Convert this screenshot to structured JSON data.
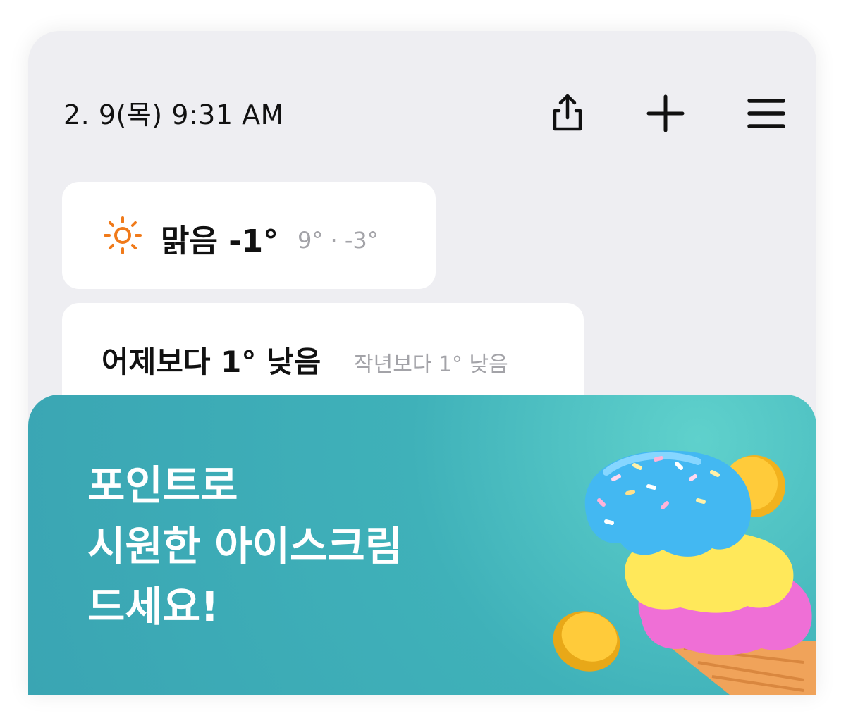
{
  "status": {
    "datetime": "2. 9(목)  9:31 AM"
  },
  "toolbar": {
    "share_icon": "share-icon",
    "add_icon": "plus-icon",
    "menu_icon": "hamburger-menu-icon"
  },
  "weather": {
    "icon": "sun-icon",
    "icon_color": "#f07a1a",
    "condition_temp": "맑음 -1°",
    "high_low": "9° · -3°"
  },
  "comparison": {
    "main": "어제보다 1° 낮음",
    "sub": "작년보다 1° 낮음"
  },
  "promo": {
    "lines": [
      "포인트로",
      "시원한 아이스크림",
      "드세요!"
    ],
    "background_color": "#3fb1b9",
    "illustration": "ice-cream-cone-with-coins"
  }
}
